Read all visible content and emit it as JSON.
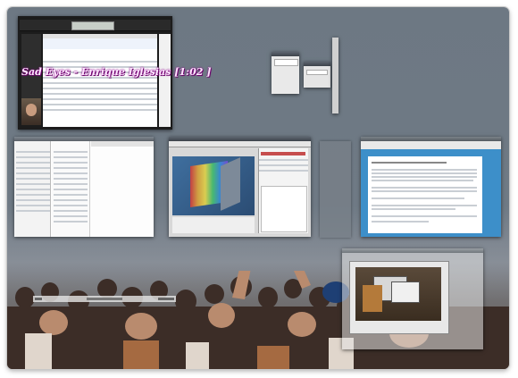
{
  "overlay_caption": "Sad Eyes - Enrique Iglesias [1:02 ]",
  "windows": [
    {
      "name": "music-player-window"
    },
    {
      "name": "small-dialog-window-1"
    },
    {
      "name": "small-dialog-window-2"
    },
    {
      "name": "vertical-toolbar-window"
    },
    {
      "name": "file-manager-window"
    },
    {
      "name": "3d-editor-window"
    },
    {
      "name": "blank-window"
    },
    {
      "name": "web-browser-window"
    },
    {
      "name": "image-viewer-window"
    },
    {
      "name": "taskbar-panel"
    }
  ],
  "colors": {
    "accent": "#4a9ad8",
    "caption_glow": "#8b0c8b"
  }
}
